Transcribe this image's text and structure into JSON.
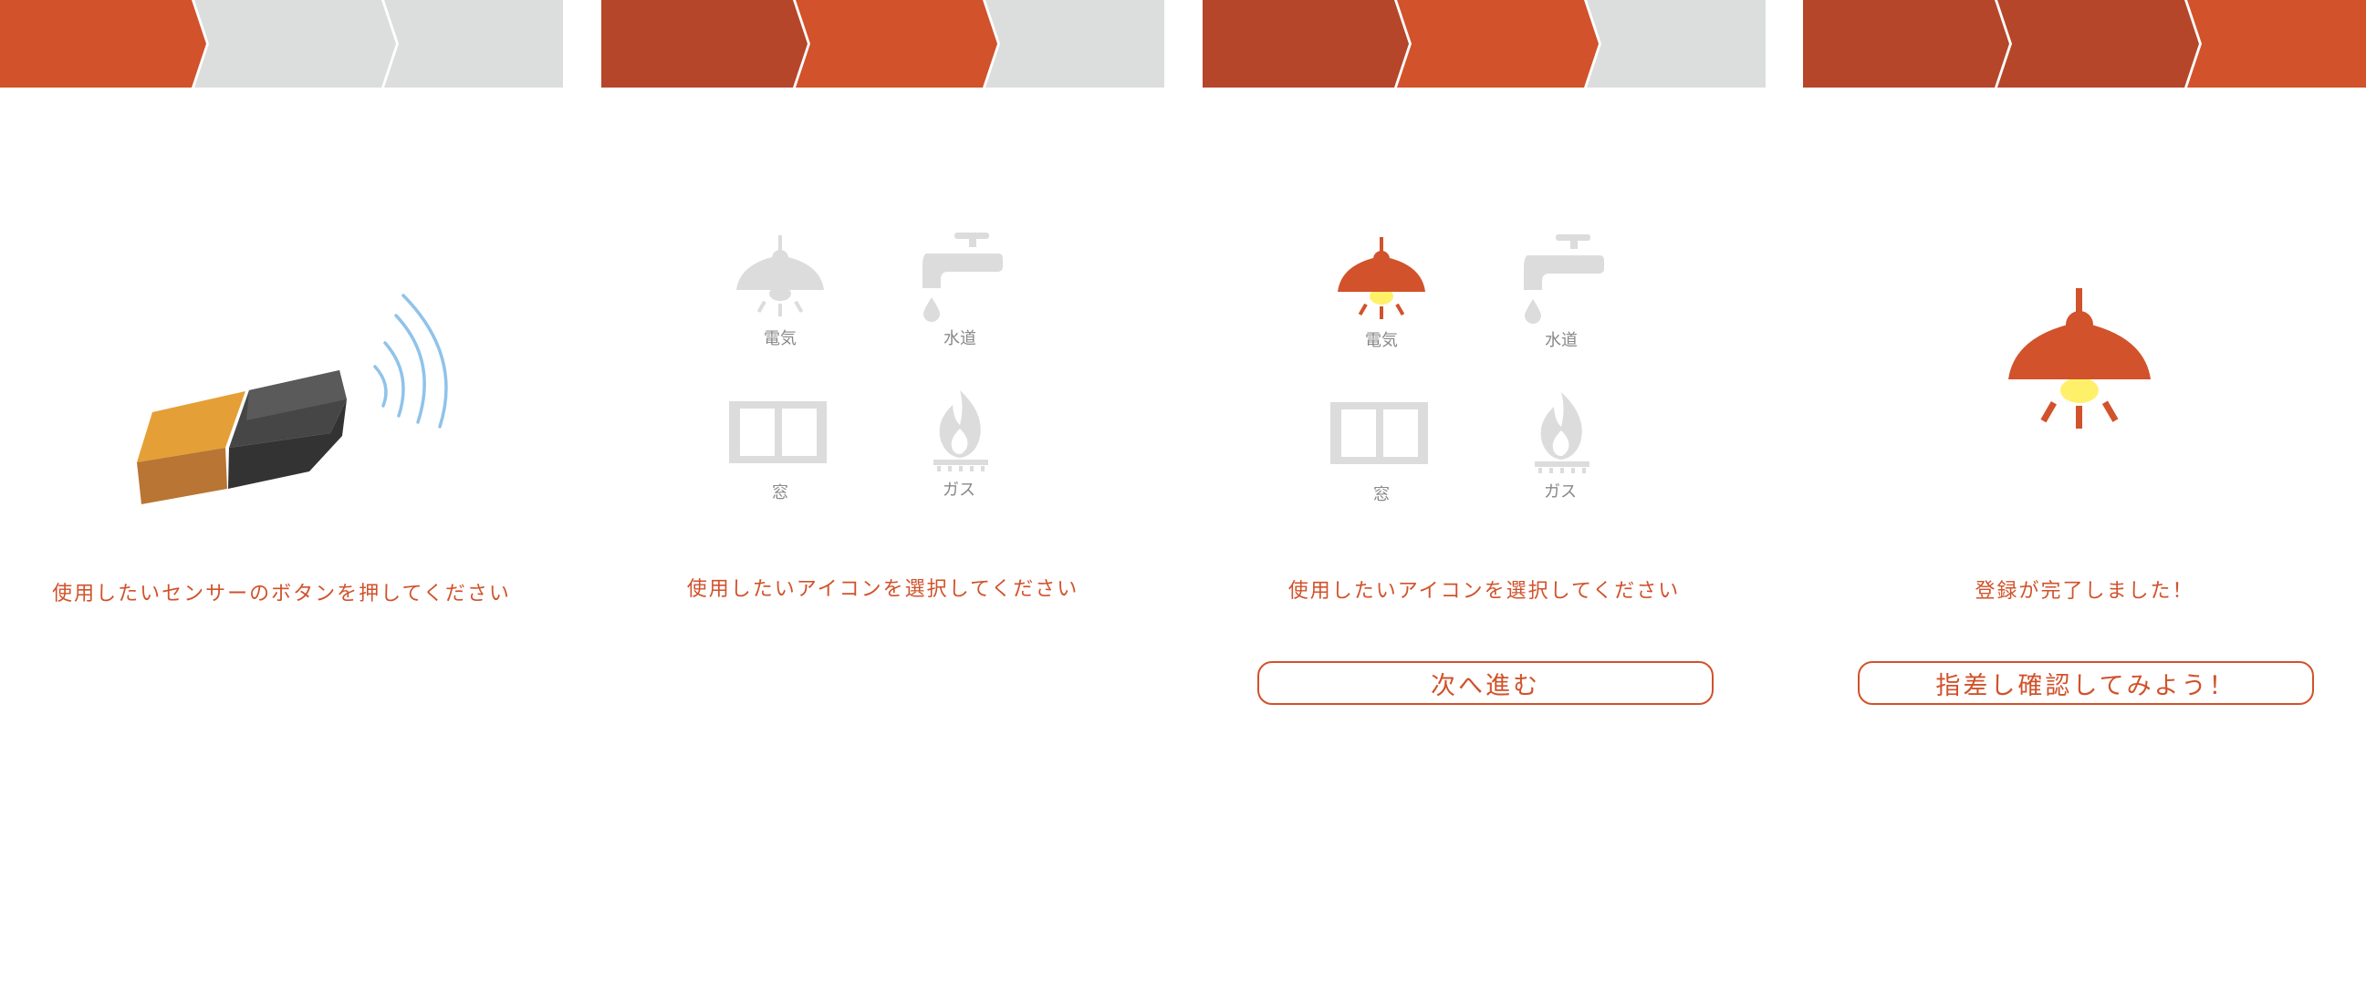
{
  "colors": {
    "step_done": "#b5462a",
    "step_active": "#d1522b",
    "step_inactive": "#dcdddd",
    "accent": "#d1522b",
    "icon_inactive": "#dcdcdc",
    "icon_label_inactive": "#888888",
    "bulb_glow": "#fff06a",
    "sensor_orange": "#e59f37",
    "sensor_dark": "#464646",
    "wave_blue": "#8fc3ea"
  },
  "steps_total": 3,
  "icon_labels": {
    "electricity": "電気",
    "water": "水道",
    "window": "窓",
    "gas": "ガス"
  },
  "panels": [
    {
      "step": 1,
      "instruction": "使用したいセンサーのボタンを押してください",
      "illustration": "sensor-icon"
    },
    {
      "step": 2,
      "instruction": "使用したいアイコンを選択してください",
      "selected_icon": "none"
    },
    {
      "step": 2,
      "instruction": "使用したいアイコンを選択してください",
      "selected_icon": "electricity",
      "button_label": "次へ進む"
    },
    {
      "step": 3,
      "instruction": "登録が完了しました！",
      "illustration": "lamp-icon",
      "button_label": "指差し確認してみよう！"
    }
  ]
}
